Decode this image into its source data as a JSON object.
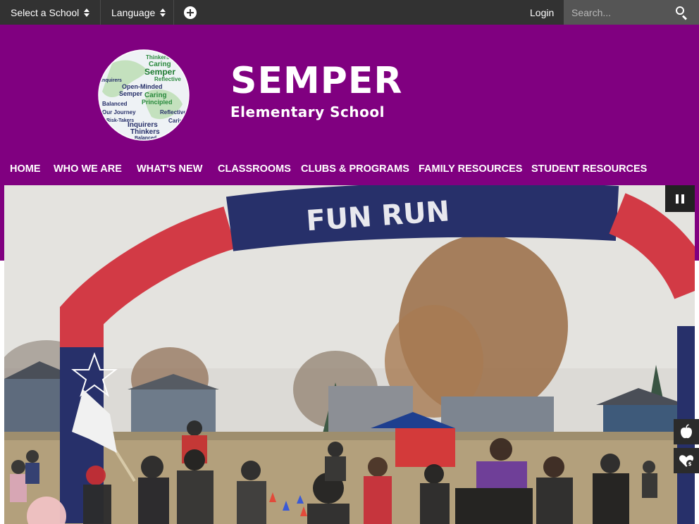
{
  "topbar": {
    "select_school": "Select a School",
    "language": "Language",
    "login": "Login",
    "search_placeholder": "Search..."
  },
  "header": {
    "title": "SEMPER",
    "subtitle": "Elementary School",
    "logo_words": [
      "Thinkers",
      "Caring",
      "Semper",
      "Reflective",
      "Inquirers",
      "Open-Minded",
      "Semper",
      "Caring",
      "Principled",
      "Balanced",
      "Our Journey",
      "Risk-Takers",
      "Inquirers",
      "Thinkers",
      "Balanced"
    ]
  },
  "nav": {
    "items": [
      "HOME",
      "WHO WE ARE",
      "WHAT'S NEW",
      "CLASSROOMS",
      "CLUBS & PROGRAMS",
      "FAMILY RESOURCES",
      "STUDENT RESOURCES"
    ]
  },
  "hero": {
    "arch_text": "FUN RUN"
  },
  "colors": {
    "topbar": "#323232",
    "header": "#800080",
    "search_box": "#555555",
    "arch_blue": "#27306a",
    "arch_red": "#d23a45"
  },
  "icons": {
    "school_select": "chevron-updown-icon",
    "language_select": "chevron-updown-icon",
    "add": "plus-circle-icon",
    "search": "search-icon",
    "pause": "pause-icon",
    "side_tab_1": "apple-icon",
    "side_tab_2": "heart-dollar-icon"
  }
}
